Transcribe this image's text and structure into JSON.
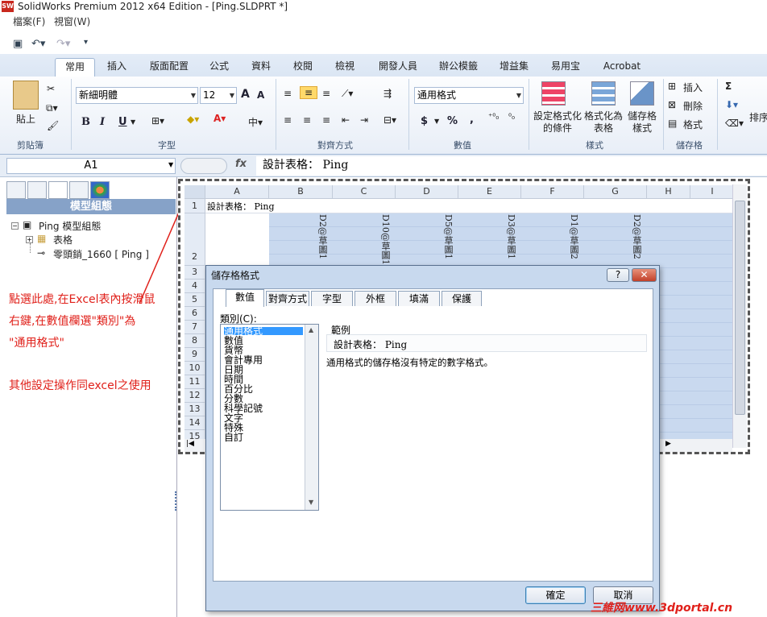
{
  "window": {
    "title": "SolidWorks Premium 2012 x64 Edition - [Ping.SLDPRT *]",
    "logo_text": "SW"
  },
  "menubar": {
    "items": [
      "檔案(F)",
      "視窗(W)"
    ]
  },
  "qat": {
    "icons": [
      "save-icon",
      "undo-icon",
      "redo-icon",
      "customize-icon"
    ]
  },
  "ribbon_tabs": [
    "常用",
    "插入",
    "版面配置",
    "公式",
    "資料",
    "校閱",
    "檢視",
    "開發人員",
    "辦公模籤",
    "增益集",
    "易用宝",
    "Acrobat"
  ],
  "ribbon": {
    "clipboard": {
      "paste": "貼上",
      "label": "剪貼簿"
    },
    "font": {
      "name": "新細明體",
      "size": "12",
      "label": "字型",
      "bold": "B",
      "italic": "I",
      "underline": "U",
      "grow": "A",
      "shrink": "A"
    },
    "alignment": {
      "label": "對齊方式"
    },
    "number": {
      "format": "通用格式",
      "label": "數值",
      "currency": "$",
      "percent": "%",
      "comma": ","
    },
    "styles": {
      "conditional": "設定格式化的條件",
      "table": "格式化為表格",
      "cell": "儲存格樣式",
      "label": "樣式"
    },
    "cells": {
      "insert": "插入",
      "delete": "刪除",
      "format": "格式",
      "label": "儲存格"
    },
    "editing": {
      "sum": "Σ",
      "sort": "排序"
    }
  },
  "formula_bar": {
    "name_box": "A1",
    "fx": "fx",
    "content": "設計表格： Ping"
  },
  "left_panel": {
    "header": "模型組態",
    "tree": [
      {
        "label": "Ping 模型組態"
      },
      {
        "label": "表格"
      },
      {
        "label": "零頭銷_1660 [ Ping ]"
      }
    ]
  },
  "annotation": {
    "lines": [
      "點選此處,在Excel表內按滑鼠",
      "右鍵,在數值欄選\"類別\"為",
      "\"通用格式\"",
      "其他設定操作同excel之使用"
    ]
  },
  "sheet": {
    "columns": [
      "A",
      "B",
      "C",
      "D",
      "E",
      "F",
      "G",
      "H",
      "I"
    ],
    "rows": [
      "1",
      "2",
      "3",
      "4",
      "5",
      "6",
      "7",
      "8",
      "9",
      "10",
      "11",
      "12",
      "13",
      "14",
      "15"
    ],
    "a1": "設計表格： Ping",
    "headers": [
      "D2@草圖1",
      "D10@草圖1",
      "D5@草圖1",
      "D3@草圖1",
      "D1@草圖2",
      "D2@草圖2"
    ]
  },
  "dialog": {
    "title": "儲存格格式",
    "help": "?",
    "close": "✕",
    "tabs": [
      "數值",
      "對齊方式",
      "字型",
      "外框",
      "填滿",
      "保護"
    ],
    "category_label": "類別(C):",
    "categories": [
      "通用格式",
      "數值",
      "貨幣",
      "會計專用",
      "日期",
      "時間",
      "百分比",
      "分數",
      "科學記號",
      "文字",
      "特殊",
      "自訂"
    ],
    "selected_category": "通用格式",
    "sample_label": "範例",
    "sample_value": "設計表格： Ping",
    "description": "通用格式的儲存格沒有特定的數字格式。",
    "ok": "確定",
    "cancel": "取消"
  },
  "watermark": "三維网www.3dportal.cn",
  "colors": {
    "accent": "#3399ff",
    "annotation": "#e0201a",
    "selection": "#c9d9ef"
  }
}
